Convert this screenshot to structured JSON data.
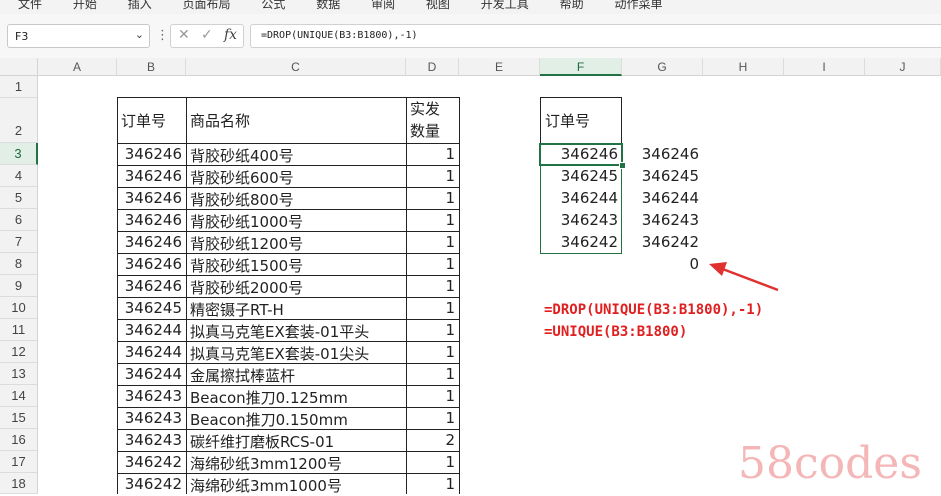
{
  "ribbon": {
    "tabs": [
      "文件",
      "开始",
      "插入",
      "页面布局",
      "公式",
      "数据",
      "审阅",
      "视图",
      "开发工具",
      "帮助",
      "动作菜单"
    ]
  },
  "formula_bar": {
    "name_box": "F3",
    "formula": "=DROP(UNIQUE(B3:B1800),-1)",
    "cancel_glyph": "✕",
    "confirm_glyph": "✓",
    "fx_label": "fx"
  },
  "columns": [
    "A",
    "B",
    "C",
    "D",
    "E",
    "F",
    "G",
    "H",
    "I",
    "J"
  ],
  "rows": [
    "1",
    "2",
    "3",
    "4",
    "5",
    "6",
    "7",
    "8",
    "9",
    "10",
    "11",
    "12",
    "13",
    "14",
    "15",
    "16",
    "17",
    "18"
  ],
  "table": {
    "headers": {
      "order": "订单号",
      "product": "商品名称",
      "qty_line1": "实发",
      "qty_line2": "数量"
    },
    "rows": [
      {
        "order": "346246",
        "product": "背胶砂纸400号",
        "qty": "1"
      },
      {
        "order": "346246",
        "product": "背胶砂纸600号",
        "qty": "1"
      },
      {
        "order": "346246",
        "product": "背胶砂纸800号",
        "qty": "1"
      },
      {
        "order": "346246",
        "product": "背胶砂纸1000号",
        "qty": "1"
      },
      {
        "order": "346246",
        "product": "背胶砂纸1200号",
        "qty": "1"
      },
      {
        "order": "346246",
        "product": "背胶砂纸1500号",
        "qty": "1"
      },
      {
        "order": "346246",
        "product": "背胶砂纸2000号",
        "qty": "1"
      },
      {
        "order": "346245",
        "product": "精密镊子RT-H",
        "qty": "1"
      },
      {
        "order": "346244",
        "product": "拟真马克笔EX套装-01平头",
        "qty": "1"
      },
      {
        "order": "346244",
        "product": "拟真马克笔EX套装-01尖头",
        "qty": "1"
      },
      {
        "order": "346244",
        "product": "金属擦拭棒蓝杆",
        "qty": "1"
      },
      {
        "order": "346243",
        "product": "Beacon推刀0.125mm",
        "qty": "1"
      },
      {
        "order": "346243",
        "product": "Beacon推刀0.150mm",
        "qty": "1"
      },
      {
        "order": "346243",
        "product": "碳纤维打磨板RCS-01",
        "qty": "2"
      },
      {
        "order": "346242",
        "product": "海绵砂纸3mm1200号",
        "qty": "1"
      },
      {
        "order": "346242",
        "product": "海绵砂纸3mm1000号",
        "qty": "1"
      }
    ]
  },
  "result_f": {
    "header": "订单号",
    "values": [
      "346246",
      "346245",
      "346244",
      "346243",
      "346242"
    ]
  },
  "result_g": {
    "values": [
      "346246",
      "346245",
      "346244",
      "346243",
      "346242",
      "0"
    ]
  },
  "annotations": {
    "formula_drop": "=DROP(UNIQUE(B3:B1800),-1)",
    "formula_unique": "=UNIQUE(B3:B1800)",
    "arrow_color": "#e03030"
  },
  "watermark": "58codes",
  "colors": {
    "accent": "#217346",
    "annotation": "#e02020"
  }
}
